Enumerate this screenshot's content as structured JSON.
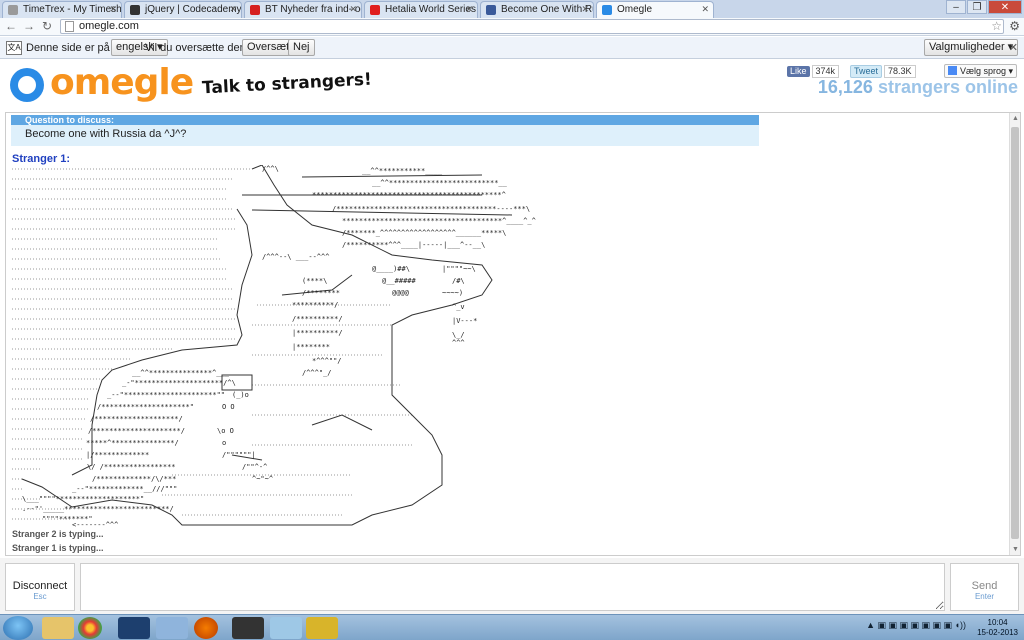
{
  "browser": {
    "tabs": [
      {
        "label": "TimeTrex - My Timesheet",
        "color": "#7a7a7a"
      },
      {
        "label": "jQuery | Codecademy",
        "color": "#333333"
      },
      {
        "label": "BT Nyheder fra ind- og ud",
        "color": "#d62020"
      },
      {
        "label": "Hetalia World Series - Exte",
        "color": "#e01e1e"
      },
      {
        "label": "Become One With Russia",
        "color": "#3a5a9a"
      },
      {
        "label": "Omegle",
        "color": "#2a8be6"
      }
    ],
    "url": "omegle.com",
    "window_controls": {
      "minimize": "–",
      "restore": "❐",
      "close": "✕"
    }
  },
  "translate_bar": {
    "prompt": "Denne side er på",
    "language": "engelsk",
    "question": "Vil du oversætte den?",
    "translate_button": "Oversæt",
    "no_button": "Nej",
    "options_button": "Valgmuligheder"
  },
  "header": {
    "logo_text": "omegle",
    "tagline": "Talk to strangers!",
    "facebook": {
      "label": "Like",
      "count": "374k"
    },
    "twitter": {
      "label": "Tweet",
      "count": "78.3K"
    },
    "google_translate": "Vælg sprog",
    "online_count": "16,126",
    "online_label": "strangers online"
  },
  "chat": {
    "question_heading": "Question to discuss:",
    "question_text": "Become one with Russia da ^J^?",
    "stranger_label": "Stranger 1:",
    "typing_1": "Stranger 2 is typing...",
    "typing_2": "Stranger 1 is typing..."
  },
  "controls": {
    "disconnect_label": "Disconnect",
    "disconnect_hint": "Esc",
    "send_label": "Send",
    "send_hint": "Enter"
  },
  "taskbar": {
    "clock_time": "10:04",
    "clock_date": "15-02-2013"
  }
}
